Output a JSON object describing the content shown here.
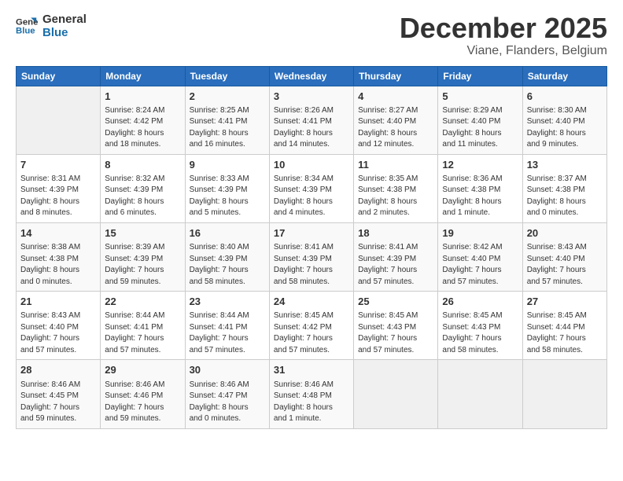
{
  "header": {
    "logo_line1": "General",
    "logo_line2": "Blue",
    "month": "December 2025",
    "location": "Viane, Flanders, Belgium"
  },
  "weekdays": [
    "Sunday",
    "Monday",
    "Tuesday",
    "Wednesday",
    "Thursday",
    "Friday",
    "Saturday"
  ],
  "weeks": [
    [
      {
        "day": "",
        "info": ""
      },
      {
        "day": "1",
        "info": "Sunrise: 8:24 AM\nSunset: 4:42 PM\nDaylight: 8 hours\nand 18 minutes."
      },
      {
        "day": "2",
        "info": "Sunrise: 8:25 AM\nSunset: 4:41 PM\nDaylight: 8 hours\nand 16 minutes."
      },
      {
        "day": "3",
        "info": "Sunrise: 8:26 AM\nSunset: 4:41 PM\nDaylight: 8 hours\nand 14 minutes."
      },
      {
        "day": "4",
        "info": "Sunrise: 8:27 AM\nSunset: 4:40 PM\nDaylight: 8 hours\nand 12 minutes."
      },
      {
        "day": "5",
        "info": "Sunrise: 8:29 AM\nSunset: 4:40 PM\nDaylight: 8 hours\nand 11 minutes."
      },
      {
        "day": "6",
        "info": "Sunrise: 8:30 AM\nSunset: 4:40 PM\nDaylight: 8 hours\nand 9 minutes."
      }
    ],
    [
      {
        "day": "7",
        "info": "Sunrise: 8:31 AM\nSunset: 4:39 PM\nDaylight: 8 hours\nand 8 minutes."
      },
      {
        "day": "8",
        "info": "Sunrise: 8:32 AM\nSunset: 4:39 PM\nDaylight: 8 hours\nand 6 minutes."
      },
      {
        "day": "9",
        "info": "Sunrise: 8:33 AM\nSunset: 4:39 PM\nDaylight: 8 hours\nand 5 minutes."
      },
      {
        "day": "10",
        "info": "Sunrise: 8:34 AM\nSunset: 4:39 PM\nDaylight: 8 hours\nand 4 minutes."
      },
      {
        "day": "11",
        "info": "Sunrise: 8:35 AM\nSunset: 4:38 PM\nDaylight: 8 hours\nand 2 minutes."
      },
      {
        "day": "12",
        "info": "Sunrise: 8:36 AM\nSunset: 4:38 PM\nDaylight: 8 hours\nand 1 minute."
      },
      {
        "day": "13",
        "info": "Sunrise: 8:37 AM\nSunset: 4:38 PM\nDaylight: 8 hours\nand 0 minutes."
      }
    ],
    [
      {
        "day": "14",
        "info": "Sunrise: 8:38 AM\nSunset: 4:38 PM\nDaylight: 8 hours\nand 0 minutes."
      },
      {
        "day": "15",
        "info": "Sunrise: 8:39 AM\nSunset: 4:39 PM\nDaylight: 7 hours\nand 59 minutes."
      },
      {
        "day": "16",
        "info": "Sunrise: 8:40 AM\nSunset: 4:39 PM\nDaylight: 7 hours\nand 58 minutes."
      },
      {
        "day": "17",
        "info": "Sunrise: 8:41 AM\nSunset: 4:39 PM\nDaylight: 7 hours\nand 58 minutes."
      },
      {
        "day": "18",
        "info": "Sunrise: 8:41 AM\nSunset: 4:39 PM\nDaylight: 7 hours\nand 57 minutes."
      },
      {
        "day": "19",
        "info": "Sunrise: 8:42 AM\nSunset: 4:40 PM\nDaylight: 7 hours\nand 57 minutes."
      },
      {
        "day": "20",
        "info": "Sunrise: 8:43 AM\nSunset: 4:40 PM\nDaylight: 7 hours\nand 57 minutes."
      }
    ],
    [
      {
        "day": "21",
        "info": "Sunrise: 8:43 AM\nSunset: 4:40 PM\nDaylight: 7 hours\nand 57 minutes."
      },
      {
        "day": "22",
        "info": "Sunrise: 8:44 AM\nSunset: 4:41 PM\nDaylight: 7 hours\nand 57 minutes."
      },
      {
        "day": "23",
        "info": "Sunrise: 8:44 AM\nSunset: 4:41 PM\nDaylight: 7 hours\nand 57 minutes."
      },
      {
        "day": "24",
        "info": "Sunrise: 8:45 AM\nSunset: 4:42 PM\nDaylight: 7 hours\nand 57 minutes."
      },
      {
        "day": "25",
        "info": "Sunrise: 8:45 AM\nSunset: 4:43 PM\nDaylight: 7 hours\nand 57 minutes."
      },
      {
        "day": "26",
        "info": "Sunrise: 8:45 AM\nSunset: 4:43 PM\nDaylight: 7 hours\nand 58 minutes."
      },
      {
        "day": "27",
        "info": "Sunrise: 8:45 AM\nSunset: 4:44 PM\nDaylight: 7 hours\nand 58 minutes."
      }
    ],
    [
      {
        "day": "28",
        "info": "Sunrise: 8:46 AM\nSunset: 4:45 PM\nDaylight: 7 hours\nand 59 minutes."
      },
      {
        "day": "29",
        "info": "Sunrise: 8:46 AM\nSunset: 4:46 PM\nDaylight: 7 hours\nand 59 minutes."
      },
      {
        "day": "30",
        "info": "Sunrise: 8:46 AM\nSunset: 4:47 PM\nDaylight: 8 hours\nand 0 minutes."
      },
      {
        "day": "31",
        "info": "Sunrise: 8:46 AM\nSunset: 4:48 PM\nDaylight: 8 hours\nand 1 minute."
      },
      {
        "day": "",
        "info": ""
      },
      {
        "day": "",
        "info": ""
      },
      {
        "day": "",
        "info": ""
      }
    ]
  ]
}
